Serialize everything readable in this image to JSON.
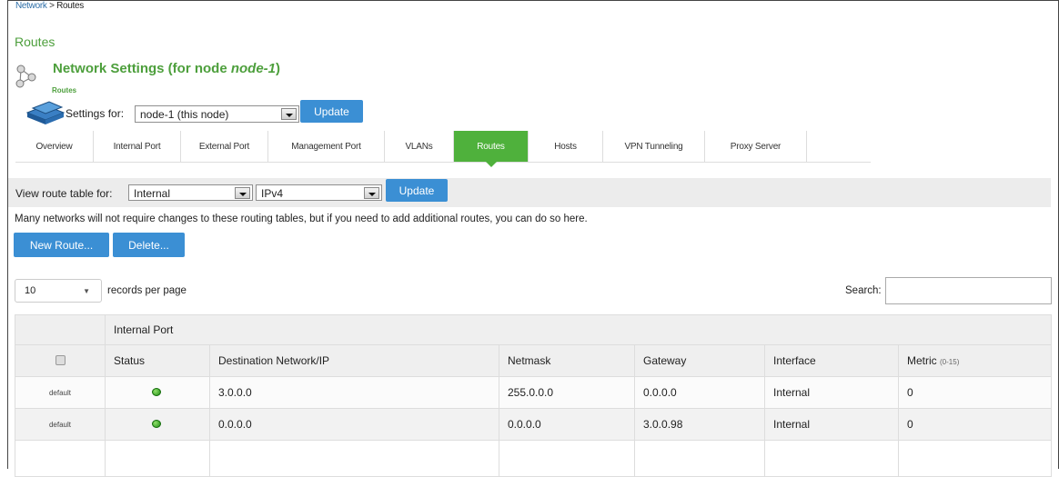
{
  "breadcrumb": {
    "parent": "Network",
    "separator": ">",
    "current": "Routes"
  },
  "page_title": "Routes",
  "settings_header": {
    "title_prefix": "Network Settings (for node ",
    "node_name": "node-1",
    "title_suffix": ")",
    "subtitle": "Routes"
  },
  "settings_for": {
    "label": "Settings for:",
    "selected": "node-1 (this node)",
    "update_label": "Update"
  },
  "tabs": [
    {
      "label": "Overview"
    },
    {
      "label": "Internal Port"
    },
    {
      "label": "External Port"
    },
    {
      "label": "Management Port"
    },
    {
      "label": "VLANs"
    },
    {
      "label": "Routes"
    },
    {
      "label": "Hosts"
    },
    {
      "label": "VPN Tunneling"
    },
    {
      "label": "Proxy Server"
    }
  ],
  "active_tab": "Routes",
  "route_filter": {
    "label": "View route table for:",
    "table_selected": "Internal",
    "ip_selected": "IPv4",
    "update_label": "Update"
  },
  "info_text": "Many networks will not require changes to these routing tables, but if you need to add additional routes, you can do so here.",
  "actions": {
    "new_route": "New Route...",
    "delete": "Delete..."
  },
  "pagination": {
    "page_size": "10",
    "records_label": "records per page"
  },
  "search": {
    "label": "Search:",
    "value": ""
  },
  "table": {
    "group_header": "Internal Port",
    "columns": {
      "status": "Status",
      "destination": "Destination Network/IP",
      "netmask": "Netmask",
      "gateway": "Gateway",
      "interface": "Interface",
      "metric": "Metric",
      "metric_range": "(0-15)"
    },
    "rows": [
      {
        "type": "default",
        "status": "green",
        "destination": "3.0.0.0",
        "netmask": "255.0.0.0",
        "gateway": "0.0.0.0",
        "interface": "Internal",
        "metric": "0"
      },
      {
        "type": "default",
        "status": "green",
        "destination": "0.0.0.0",
        "netmask": "0.0.0.0",
        "gateway": "3.0.0.98",
        "interface": "Internal",
        "metric": "0"
      }
    ]
  },
  "colors": {
    "accent_green": "#4fb13c",
    "title_green": "#4d9f3c",
    "button_blue": "#3b8fd4",
    "link_blue": "#2d6ea8"
  }
}
